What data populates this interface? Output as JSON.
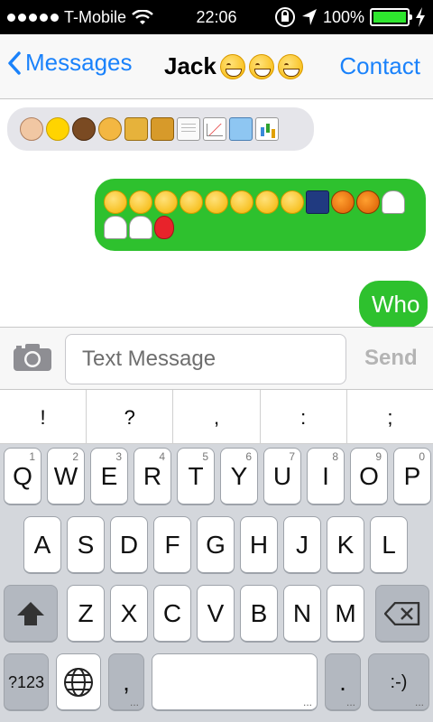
{
  "status_bar": {
    "carrier": "T-Mobile",
    "time": "22:06",
    "battery": "100%",
    "battery_level": 1.0
  },
  "nav": {
    "back_label": "Messages",
    "title": "Jack",
    "contact_label": "Contact"
  },
  "conversation": {
    "incoming_emojis": [
      "hamster",
      "chick",
      "horse",
      "cat",
      "trumpet",
      "saxophone",
      "document",
      "chart-up",
      "carousel",
      "bar-chart"
    ],
    "outgoing_emojis": [
      "kissing-face",
      "confounded-face",
      "blushing-face",
      "tongue-wink-face",
      "crazy-face",
      "pensive-face",
      "grinning-face",
      "grinning-face",
      "night-city",
      "jack-o-lantern",
      "jack-o-lantern",
      "ghost",
      "ghost",
      "ghost",
      "balloon"
    ],
    "outgoing_text": "Who"
  },
  "input": {
    "placeholder": "Text Message",
    "send_label": "Send"
  },
  "punctuation": [
    "!",
    "?",
    ",",
    ":",
    ";"
  ],
  "keyboard": {
    "row1": [
      {
        "k": "Q",
        "n": "1"
      },
      {
        "k": "W",
        "n": "2"
      },
      {
        "k": "E",
        "n": "3"
      },
      {
        "k": "R",
        "n": "4"
      },
      {
        "k": "T",
        "n": "5"
      },
      {
        "k": "Y",
        "n": "6"
      },
      {
        "k": "U",
        "n": "7"
      },
      {
        "k": "I",
        "n": "8"
      },
      {
        "k": "O",
        "n": "9"
      },
      {
        "k": "P",
        "n": "0"
      }
    ],
    "row2": [
      "A",
      "S",
      "D",
      "F",
      "G",
      "H",
      "J",
      "K",
      "L"
    ],
    "row3": [
      "Z",
      "X",
      "C",
      "V",
      "B",
      "N",
      "M"
    ],
    "mode_label": "?123",
    "comma": ",",
    "period": ".",
    "smiley": ":-)",
    "ellipsis": "..."
  }
}
